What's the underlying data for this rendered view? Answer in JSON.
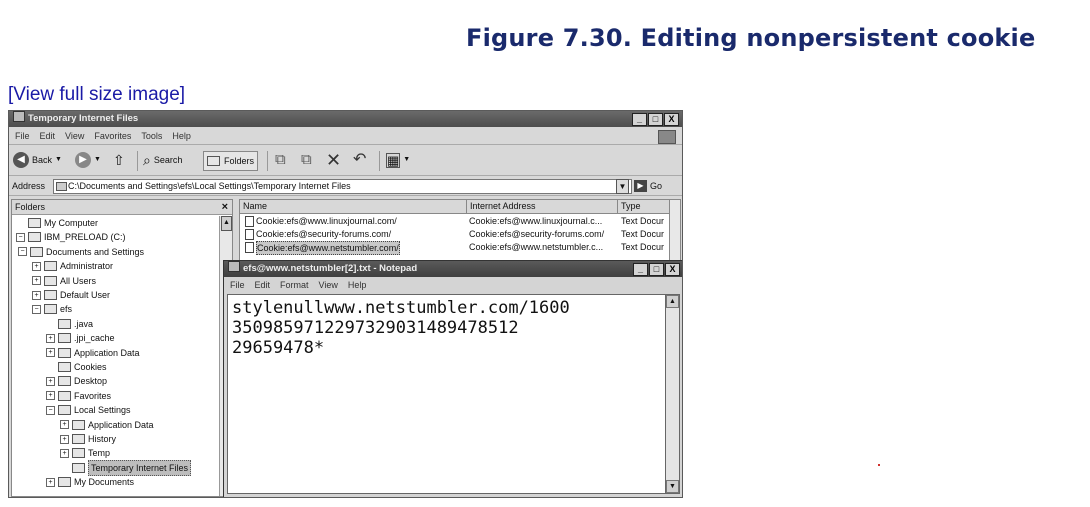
{
  "figure": {
    "title": "Figure 7.30. Editing nonpersistent cookie",
    "view_link": "[View full size image]"
  },
  "explorer": {
    "title": "Temporary Internet Files",
    "window_buttons": [
      "_",
      "□",
      "X"
    ],
    "menu": [
      "File",
      "Edit",
      "View",
      "Favorites",
      "Tools",
      "Help"
    ],
    "toolbar": {
      "back": "Back",
      "search": "Search",
      "folders": "Folders"
    },
    "address": {
      "label": "Address",
      "value": "C:\\Documents and Settings\\efs\\Local Settings\\Temporary Internet Files",
      "go": "Go"
    },
    "folders": {
      "header": "Folders",
      "close": "×",
      "tree": [
        {
          "label": "My Computer",
          "depth": 0,
          "expander": ""
        },
        {
          "label": "IBM_PRELOAD (C:)",
          "depth": 0,
          "expander": "−"
        },
        {
          "label": "Documents and Settings",
          "depth": 1,
          "expander": "−"
        },
        {
          "label": "Administrator",
          "depth": 2,
          "expander": "+"
        },
        {
          "label": "All Users",
          "depth": 2,
          "expander": "+"
        },
        {
          "label": "Default User",
          "depth": 2,
          "expander": "+"
        },
        {
          "label": "efs",
          "depth": 2,
          "expander": "−"
        },
        {
          "label": ".java",
          "depth": 3,
          "expander": ""
        },
        {
          "label": ".jpi_cache",
          "depth": 3,
          "expander": "+"
        },
        {
          "label": "Application Data",
          "depth": 3,
          "expander": "+"
        },
        {
          "label": "Cookies",
          "depth": 3,
          "expander": ""
        },
        {
          "label": "Desktop",
          "depth": 3,
          "expander": "+"
        },
        {
          "label": "Favorites",
          "depth": 3,
          "expander": "+"
        },
        {
          "label": "Local Settings",
          "depth": 3,
          "expander": "−"
        },
        {
          "label": "Application Data",
          "depth": 4,
          "expander": "+"
        },
        {
          "label": "History",
          "depth": 4,
          "expander": "+"
        },
        {
          "label": "Temp",
          "depth": 4,
          "expander": "+"
        },
        {
          "label": "Temporary Internet Files",
          "depth": 4,
          "expander": ""
        },
        {
          "label": "My Documents",
          "depth": 3,
          "expander": "+"
        }
      ]
    },
    "files": {
      "columns": [
        "Name",
        "Internet Address",
        "Type"
      ],
      "rows": [
        {
          "name": "Cookie:efs@www.linuxjournal.com/",
          "address": "Cookie:efs@www.linuxjournal.c...",
          "type": "Text Docur"
        },
        {
          "name": "Cookie:efs@security-forums.com/",
          "address": "Cookie:efs@security-forums.com/",
          "type": "Text Docur"
        },
        {
          "name": "Cookie:efs@www.netstumbler.com/",
          "address": "Cookie:efs@www.netstumbler.c...",
          "type": "Text Docur"
        }
      ]
    }
  },
  "notepad": {
    "title": "efs@www.netstumbler[2].txt - Notepad",
    "menu": [
      "File",
      "Edit",
      "Format",
      "View",
      "Help"
    ],
    "content": "stylenullwww.netstumbler.com/1600\n3509859712297329031489478512\n29659478*"
  }
}
